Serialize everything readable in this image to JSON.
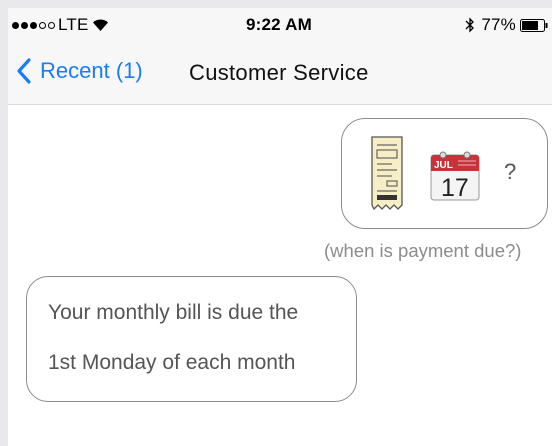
{
  "status_bar": {
    "carrier": "LTE",
    "time": "9:22 AM",
    "battery_percent": "77%",
    "signal_bars_filled": 3,
    "signal_bars_total": 5,
    "battery_level": 0.77,
    "icons": [
      "signal-dots-icon",
      "wifi-icon",
      "bluetooth-icon",
      "battery-icon"
    ]
  },
  "nav": {
    "back_label": "Recent (1)",
    "title": "Customer Service",
    "accent_color": "#1a7cf7"
  },
  "messages": {
    "outgoing": {
      "icons": [
        "receipt-icon",
        "calendar-icon"
      ],
      "calendar_month": "JUL",
      "calendar_day": "17",
      "trailing": "?",
      "caption": "(when is payment due?)"
    },
    "incoming": {
      "lines": [
        "Your monthly bill is due the",
        "1st Monday of each month"
      ]
    }
  }
}
